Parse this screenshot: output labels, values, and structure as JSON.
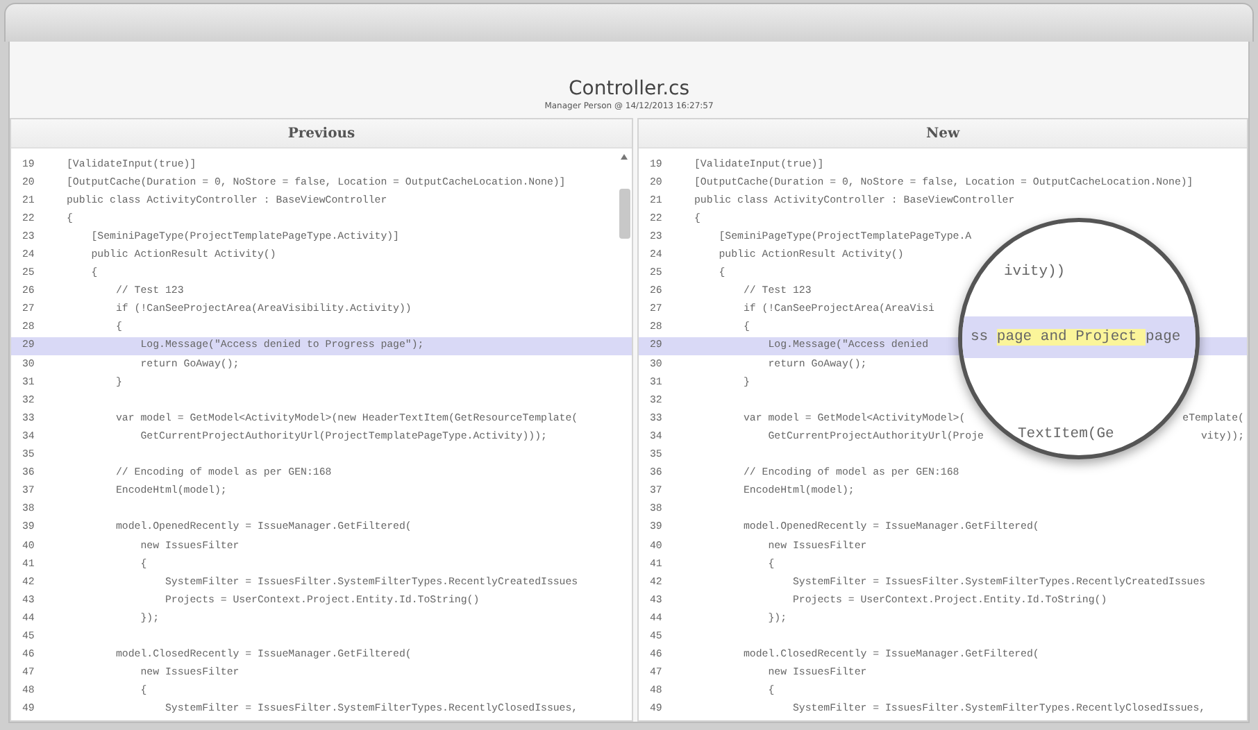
{
  "file": {
    "title": "Controller.cs",
    "subtitle": "Manager Person @ 14/12/2013 16:27:57"
  },
  "left_pane": {
    "title": "Previous",
    "lines": [
      {
        "number": "19",
        "text": "[ValidateInput(true)]",
        "changed": false
      },
      {
        "number": "20",
        "text": "[OutputCache(Duration = 0, NoStore = false, Location = OutputCacheLocation.None)]",
        "changed": false
      },
      {
        "number": "21",
        "text": "public class ActivityController : BaseViewController",
        "changed": false
      },
      {
        "number": "22",
        "text": "{",
        "changed": false
      },
      {
        "number": "23",
        "text": "    [SeminiPageType(ProjectTemplatePageType.Activity)]",
        "changed": false
      },
      {
        "number": "24",
        "text": "    public ActionResult Activity()",
        "changed": false
      },
      {
        "number": "25",
        "text": "    {",
        "changed": false
      },
      {
        "number": "26",
        "text": "        // Test 123",
        "changed": false
      },
      {
        "number": "27",
        "text": "        if (!CanSeeProjectArea(AreaVisibility.Activity))",
        "changed": false
      },
      {
        "number": "28",
        "text": "        {",
        "changed": false
      },
      {
        "number": "29",
        "text": "            Log.Message(\"Access denied to Progress page\");",
        "changed": true
      },
      {
        "number": "30",
        "text": "            return GoAway();",
        "changed": false
      },
      {
        "number": "31",
        "text": "        }",
        "changed": false
      },
      {
        "number": "32",
        "changed": false
      },
      {
        "number": "33",
        "text": "        var model = GetModel<ActivityModel>(new HeaderTextItem(GetResourceTemplate(",
        "changed": false
      },
      {
        "number": "34",
        "text": "            GetCurrentProjectAuthorityUrl(ProjectTemplatePageType.Activity)));",
        "changed": false
      },
      {
        "number": "35",
        "changed": false
      },
      {
        "number": "36",
        "text": "        // Encoding of model as per GEN:168",
        "changed": false
      },
      {
        "number": "37",
        "text": "        EncodeHtml(model);",
        "changed": false
      },
      {
        "number": "38",
        "changed": false
      },
      {
        "number": "39",
        "text": "        model.OpenedRecently = IssueManager.GetFiltered(",
        "changed": false
      },
      {
        "number": "40",
        "text": "            new IssuesFilter",
        "changed": false
      },
      {
        "number": "41",
        "text": "            {",
        "changed": false
      },
      {
        "number": "42",
        "text": "                SystemFilter = IssuesFilter.SystemFilterTypes.RecentlyCreatedIssues",
        "changed": false
      },
      {
        "number": "43",
        "text": "                Projects = UserContext.Project.Entity.Id.ToString()",
        "changed": false
      },
      {
        "number": "44",
        "text": "            });",
        "changed": false
      },
      {
        "number": "45",
        "changed": false
      },
      {
        "number": "46",
        "text": "        model.ClosedRecently = IssueManager.GetFiltered(",
        "changed": false
      },
      {
        "number": "47",
        "text": "            new IssuesFilter",
        "changed": false
      },
      {
        "number": "48",
        "text": "            {",
        "changed": false
      },
      {
        "number": "49",
        "text": "                SystemFilter = IssuesFilter.SystemFilterTypes.RecentlyClosedIssues,",
        "changed": false
      }
    ]
  },
  "right_pane": {
    "title": "New",
    "lines": [
      {
        "number": "19",
        "text": "[ValidateInput(true)]",
        "changed": false
      },
      {
        "number": "20",
        "text": "[OutputCache(Duration = 0, NoStore = false, Location = OutputCacheLocation.None)]",
        "changed": false
      },
      {
        "number": "21",
        "text": "public class ActivityController : BaseViewController",
        "changed": false
      },
      {
        "number": "22",
        "text": "{",
        "changed": false
      },
      {
        "number": "23",
        "text": "    [SeminiPageType(ProjectTemplatePageType.A",
        "changed": false
      },
      {
        "number": "24",
        "text": "    public ActionResult Activity()",
        "changed": false
      },
      {
        "number": "25",
        "text": "    {",
        "changed": false
      },
      {
        "number": "26",
        "text": "        // Test 123",
        "changed": false
      },
      {
        "number": "27",
        "text": "        if (!CanSeeProjectArea(AreaVisi",
        "changed": false
      },
      {
        "number": "28",
        "text": "        {",
        "changed": false
      },
      {
        "number": "29",
        "text": "            Log.Message(\"Access denied",
        "changed": true
      },
      {
        "number": "30",
        "text": "            return GoAway();",
        "changed": false
      },
      {
        "number": "31",
        "text": "        }",
        "changed": false
      },
      {
        "number": "32",
        "changed": false
      },
      {
        "number": "33",
        "text": "        var model = GetModel<ActivityModel>(",
        "tail": "eTemplate(",
        "changed": false
      },
      {
        "number": "34",
        "text": "            GetCurrentProjectAuthorityUrl(Proje",
        "tail": "vity));",
        "changed": false
      },
      {
        "number": "35",
        "changed": false
      },
      {
        "number": "36",
        "text": "        // Encoding of model as per GEN:168",
        "changed": false
      },
      {
        "number": "37",
        "text": "        EncodeHtml(model);",
        "changed": false
      },
      {
        "number": "38",
        "changed": false
      },
      {
        "number": "39",
        "text": "        model.OpenedRecently = IssueManager.GetFiltered(",
        "changed": false
      },
      {
        "number": "40",
        "text": "            new IssuesFilter",
        "changed": false
      },
      {
        "number": "41",
        "text": "            {",
        "changed": false
      },
      {
        "number": "42",
        "text": "                SystemFilter = IssuesFilter.SystemFilterTypes.RecentlyCreatedIssues",
        "changed": false
      },
      {
        "number": "43",
        "text": "                Projects = UserContext.Project.Entity.Id.ToString()",
        "changed": false
      },
      {
        "number": "44",
        "text": "            });",
        "changed": false
      },
      {
        "number": "45",
        "changed": false
      },
      {
        "number": "46",
        "text": "        model.ClosedRecently = IssueManager.GetFiltered(",
        "changed": false
      },
      {
        "number": "47",
        "text": "            new IssuesFilter",
        "changed": false
      },
      {
        "number": "48",
        "text": "            {",
        "changed": false
      },
      {
        "number": "49",
        "text": "                SystemFilter = IssuesFilter.SystemFilterTypes.RecentlyClosedIssues,",
        "changed": false
      }
    ]
  },
  "magnifier": {
    "lines": [
      {
        "segments": [
          {
            "text": "ivity))",
            "highlighted": false
          }
        ],
        "changed": false
      },
      {
        "segments": [
          {
            "text": "ss ",
            "highlighted": false
          },
          {
            "text": "page and Project ",
            "highlighted": true
          },
          {
            "text": "page",
            "highlighted": false
          }
        ],
        "changed": true
      },
      {
        "segments": [
          {
            "text": "TextItem(Ge",
            "highlighted": false
          }
        ],
        "changed": false
      }
    ]
  }
}
